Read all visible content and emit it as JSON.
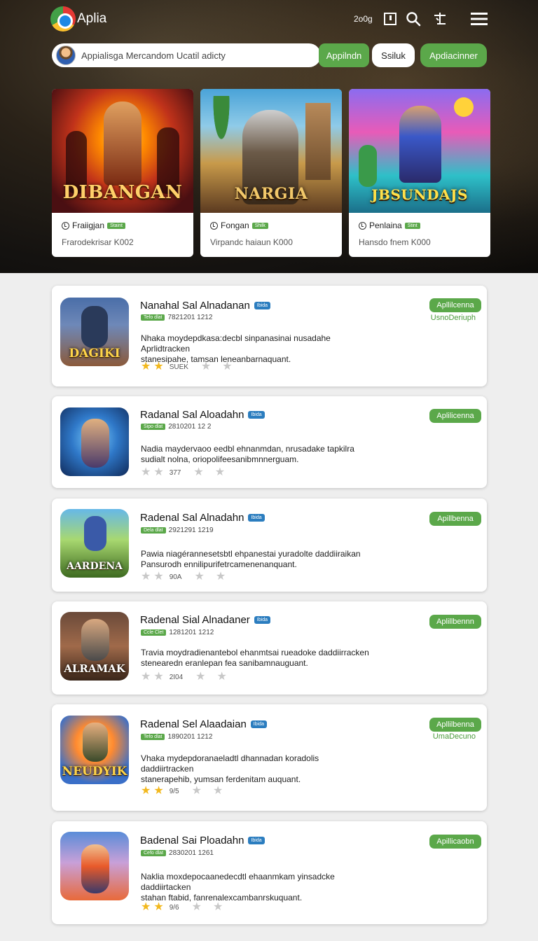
{
  "header": {
    "app_name": "Aplia",
    "coins": "2o0g",
    "search_placeholder": "Appialisga Mercandom Ucatil adicty",
    "search_button": "Appilndn",
    "secondary_button": "Ssiluk",
    "apps_button": "Apdiacinner"
  },
  "featured": [
    {
      "art_title": "DIBANGAN",
      "name": "Fraiigjan",
      "badge": "Staint",
      "sub": "Frarodekrisar K002"
    },
    {
      "art_title": "NARGIA",
      "name": "Fongan",
      "badge": "Shilk",
      "sub": "Virpandc haiaun K000"
    },
    {
      "art_title": "JBSUNDAJS",
      "name": "Penlaina",
      "badge": "Stint",
      "sub": "Hansdo fnem K000"
    }
  ],
  "list": [
    {
      "title": "Nanahal Sal Alnadanan",
      "badge": "Ibida",
      "tag": "Tefo dlat",
      "date": "7821201 1212",
      "desc_line1": "Nhaka moydepdkasa:decbl sinpanasinai nusadahe Aprlidtracken",
      "desc_line2": "stanesipahe, tamsan leneanbarnaquant.",
      "stars": 2,
      "rating_text": "SUEK",
      "cta": "Apllilcenna",
      "cta_sub": "UsnoDeriuph",
      "thumb_title": "DAGIKI"
    },
    {
      "title": "Radanal Sal Aloadahn",
      "badge": "Ibida",
      "tag": "Sipo dlat",
      "date": "2810201 12 2",
      "desc_line1": "Nadia maydervaoo eedbl ehnanmdan, nrusadake tapkilra",
      "desc_line2": "sudialt nolna, oriopolifeesanibmnnerguam.",
      "stars": 0,
      "rating_text": "377",
      "cta": "Aplilicenna",
      "cta_sub": "",
      "thumb_title": ""
    },
    {
      "title": "Radenal Sal Alnadahn",
      "badge": "Ibida",
      "tag": "Dela dlat",
      "date": "2921291 1219",
      "desc_line1": "Pawia niagérannesetsbtl ehpanestai yuradolte daddiiraikan",
      "desc_line2": "Pansurodh ennilipurifetrcamenenanquant.",
      "stars": 0,
      "rating_text": "90A",
      "cta": "Apillbenna",
      "cta_sub": "",
      "thumb_title": "AARDENA"
    },
    {
      "title": "Radenal Sial Alnadaner",
      "badge": "Ibida",
      "tag": "Ccle Clet",
      "date": "1281201 1212",
      "desc_line1": "Travia moydradienantebol ehanmtsai rueadoke daddiirracken",
      "desc_line2": "stenearedn eranlepan fea sanibamnauguant.",
      "stars": 0,
      "rating_text": "2I04",
      "cta": "Aplillbennn",
      "cta_sub": "",
      "thumb_title": "ALRAMAK"
    },
    {
      "title": "Radenal Sel Alaadaian",
      "badge": "Ibida",
      "tag": "Tefo dlat",
      "date": "1890201 1212",
      "desc_line1": "Vhaka mydepdoranaeladtl dhannadan koradolis daddiirtracken",
      "desc_line2": "stanerapehib, yumsan ferdenitam auquant.",
      "stars": 2,
      "rating_text": "9/5",
      "cta": "Apllilbenna",
      "cta_sub": "UmaDecuno",
      "thumb_title": "NEUDYIK"
    },
    {
      "title": "Badenal Sai Ploadahn",
      "badge": "Ibida",
      "tag": "Cefo dlat",
      "date": "2830201 1261",
      "desc_line1": "Naklia moxdepocaanedecdtl ehaanmkam yinsadcke daddiirtacken",
      "desc_line2": "stahan ftabid, fanrenalexcambanrskuquant.",
      "stars": 2,
      "rating_text": "9/6",
      "cta": "Apillicaobn",
      "cta_sub": "",
      "thumb_title": ""
    }
  ]
}
